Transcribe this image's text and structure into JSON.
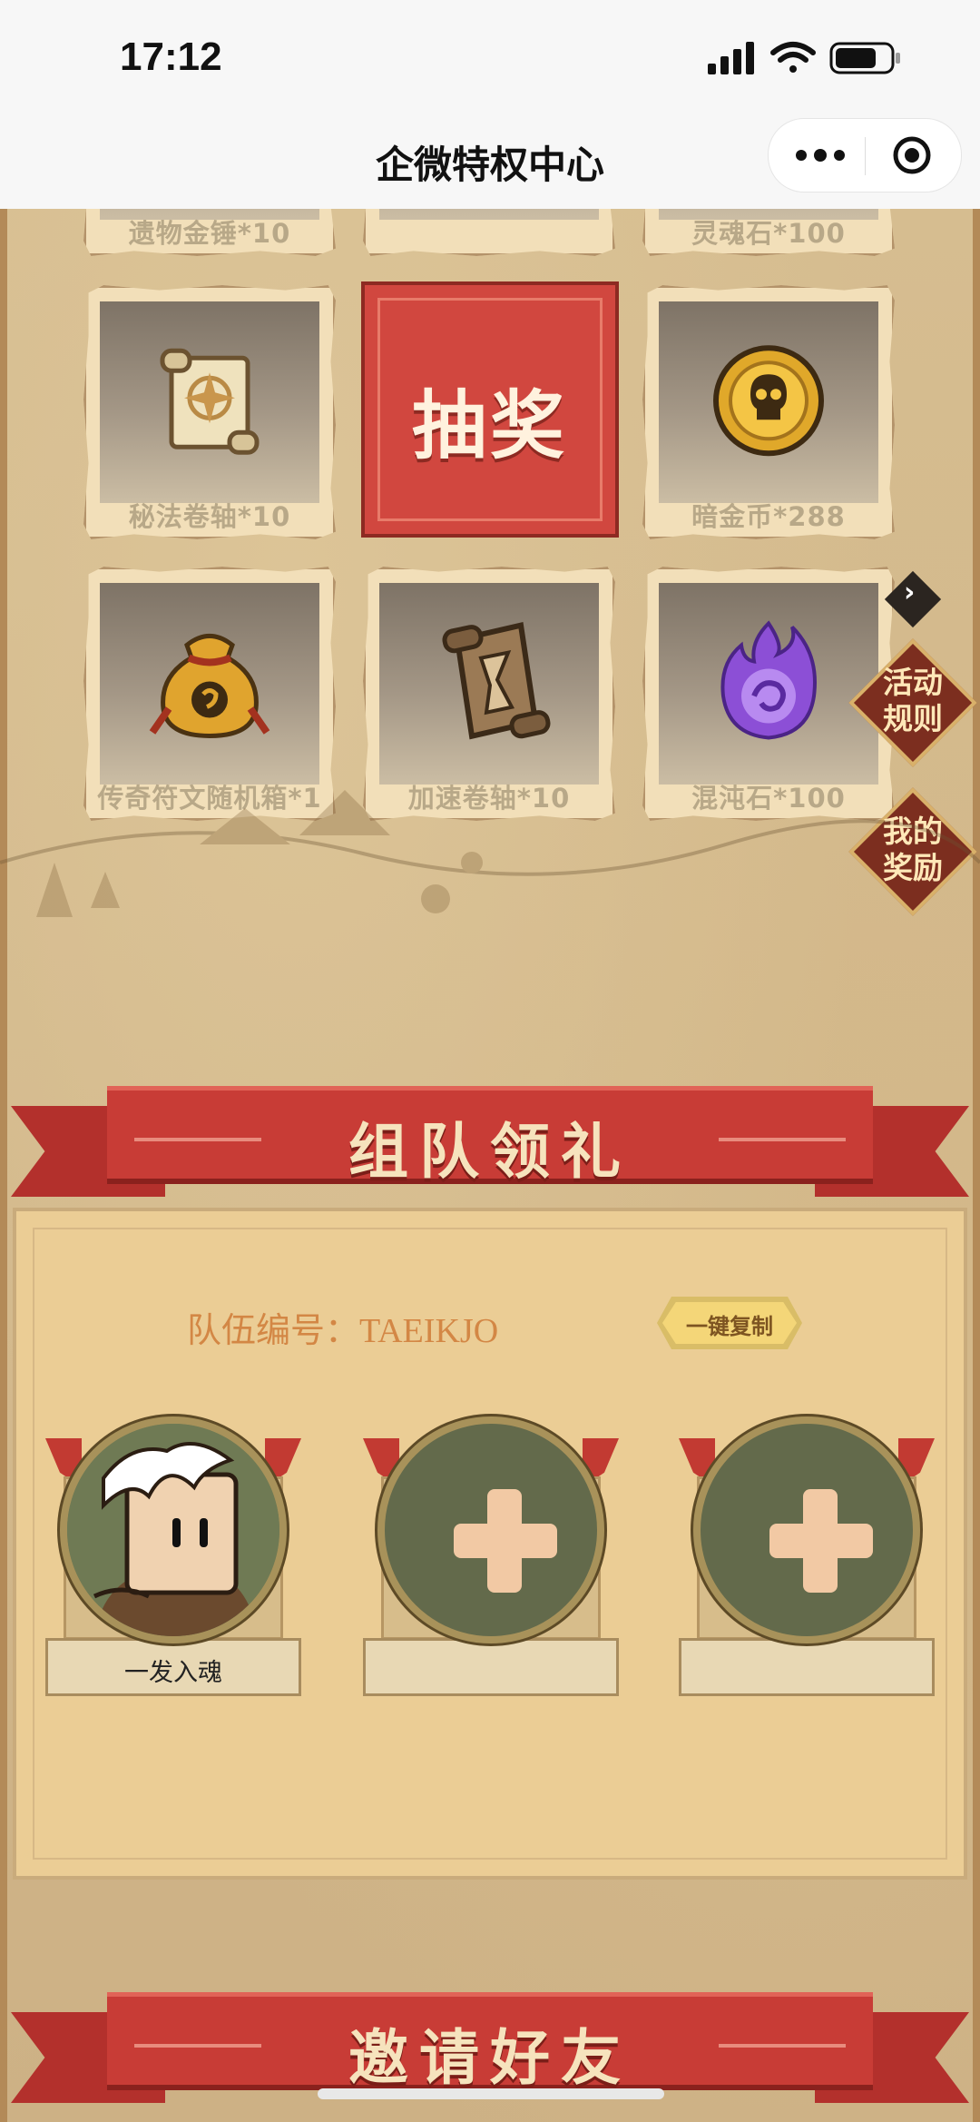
{
  "status_bar": {
    "time": "17:12"
  },
  "nav": {
    "title": "企微特权中心",
    "more_icon": "more-dots-icon",
    "close_icon": "target-circle-icon"
  },
  "prizes_top_row": [
    "遗物金锤*10",
    "",
    "灵魂石*100"
  ],
  "prizes": [
    {
      "label": "秘法卷轴*10",
      "icon": "scroll-icon"
    },
    {
      "label": "暗金币*288",
      "icon": "skull-coin-icon"
    },
    {
      "label": "传奇符文随机箱*1",
      "icon": "rune-bag-icon"
    },
    {
      "label": "加速卷轴*10",
      "icon": "hourglass-scroll-icon"
    },
    {
      "label": "混沌石*100",
      "icon": "chaos-stone-icon"
    }
  ],
  "lottery_button": "抽奖",
  "side_buttons": {
    "rules": "活动规则",
    "rewards": "我的奖励"
  },
  "team": {
    "banner_title": "组队领礼",
    "code_label": "队伍编号：TAEIKJO",
    "copy_button": "一键复制",
    "members": [
      {
        "name": "一发入魂",
        "type": "avatar"
      },
      {
        "name": "",
        "type": "empty"
      },
      {
        "name": "",
        "type": "empty"
      }
    ]
  },
  "invite": {
    "banner_title": "邀请好友"
  },
  "colors": {
    "banner_red": "#c83c36",
    "panel_bg": "#ebcd95",
    "accent_orange": "#d38745"
  }
}
